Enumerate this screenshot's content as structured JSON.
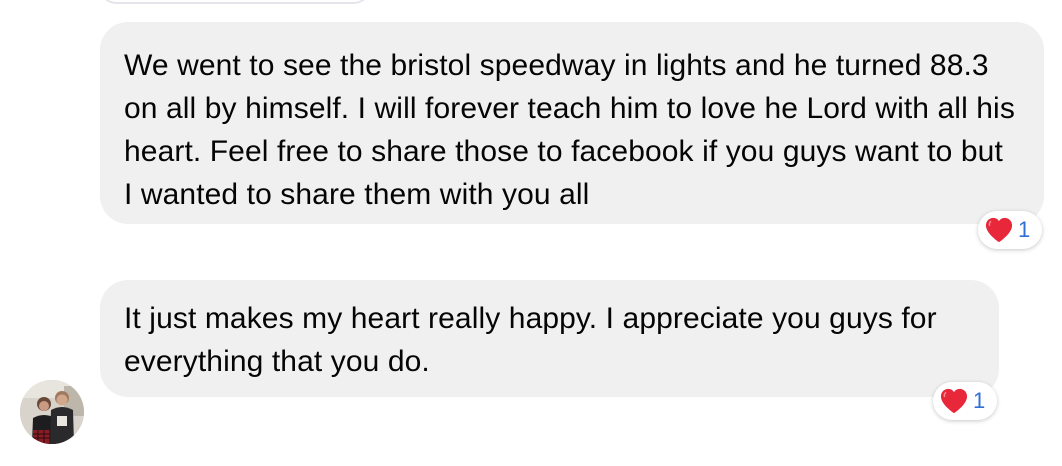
{
  "messages": [
    {
      "text": "We went to see the bristol speedway in lights and he turned 88.3 on all by himself. I will forever teach him to love he Lord with all his heart. Feel free to share those to facebook if you guys want to but I wanted to share them with you all",
      "reaction": {
        "icon": "heart-icon",
        "count": "1"
      }
    },
    {
      "text": "It just makes my heart really happy. I appreciate you guys for everything that you do.",
      "reaction": {
        "icon": "heart-icon",
        "count": "1"
      }
    }
  ],
  "sender": {
    "avatar": "avatar"
  },
  "colors": {
    "bubble": "#f0f0f0",
    "text": "#050505",
    "heart": "#e8273b",
    "count": "#2f6fd6"
  }
}
